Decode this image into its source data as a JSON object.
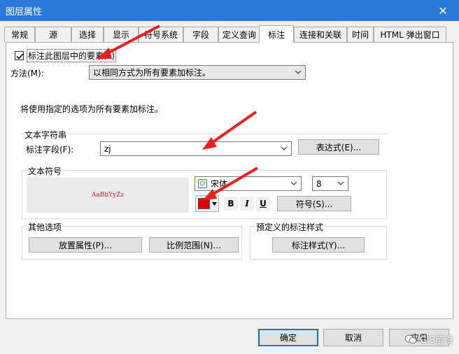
{
  "window": {
    "title": "图层属性",
    "close_glyph": "✕"
  },
  "tabs": [
    {
      "label": "常规"
    },
    {
      "label": "源"
    },
    {
      "label": "选择"
    },
    {
      "label": "显示"
    },
    {
      "label": "符号系统"
    },
    {
      "label": "字段"
    },
    {
      "label": "定义查询"
    },
    {
      "label": "标注"
    },
    {
      "label": "连接和关联"
    },
    {
      "label": "时间"
    },
    {
      "label": "HTML 弹出窗口"
    }
  ],
  "label_features_checkbox": {
    "label": "标注此图层中的要素(L)",
    "checked": true
  },
  "method": {
    "label": "方法(M):",
    "value": "以相同方式为所有要素加标注。"
  },
  "info_text": "将使用指定的选项为所有要素加标注。",
  "text_string": {
    "title": "文本字符串",
    "field_label": "标注字段(F):",
    "field_value": "zj",
    "expression_button": "表达式(E)..."
  },
  "text_symbol": {
    "title": "文本符号",
    "preview_text": "AaBbYyZz",
    "font": "宋体",
    "font_icon_glyph": "O",
    "size": "8",
    "color": "#e00000",
    "bold": "B",
    "italic": "I",
    "underline": "U",
    "symbol_button": "符号(S)..."
  },
  "other_options": {
    "title": "其他选项",
    "placement_button": "放置属性(P)...",
    "scale_button": "比例范围(N)..."
  },
  "predefined": {
    "title": "预定义的标注样式",
    "style_button": "标注样式(Y)..."
  },
  "footer": {
    "ok": "确定",
    "cancel": "取消",
    "apply": "应用"
  },
  "watermark": {
    "text": "GIS前沿"
  }
}
